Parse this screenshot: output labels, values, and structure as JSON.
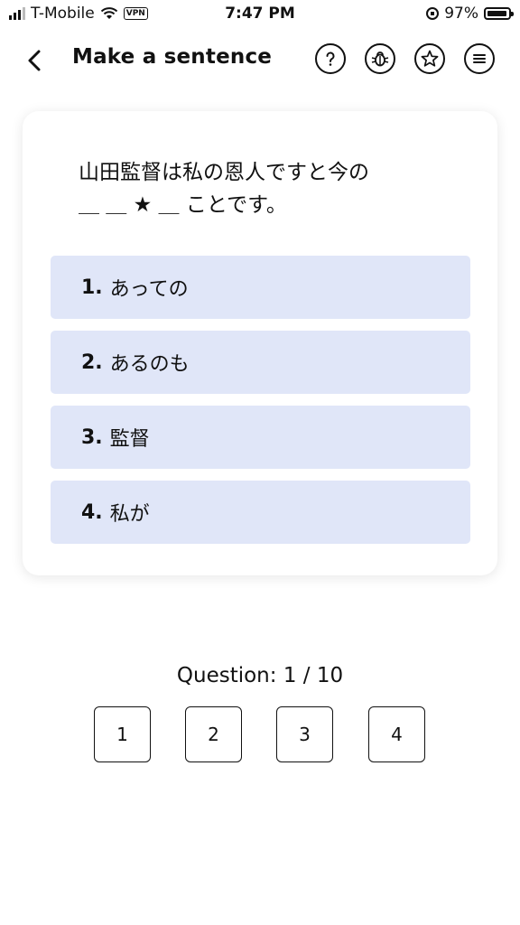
{
  "status_bar": {
    "carrier": "T-Mobile",
    "vpn_label": "VPN",
    "time": "7:47 PM",
    "battery_percent": "97%",
    "battery_level": 0.97
  },
  "header": {
    "title": "Make a sentence",
    "back_icon": "chevron-left-icon",
    "actions": [
      "help-icon",
      "bug-icon",
      "star-icon",
      "menu-icon"
    ]
  },
  "question": {
    "line1": "山田監督は私の恩人ですと今の",
    "line2": "＿ ＿ ★ ＿ ことです。"
  },
  "options": [
    {
      "number": "1.",
      "text": "あっての"
    },
    {
      "number": "2.",
      "text": "あるのも"
    },
    {
      "number": "3.",
      "text": "監督"
    },
    {
      "number": "4.",
      "text": "私が"
    }
  ],
  "progress": {
    "label": "Question: 1 / 10"
  },
  "answer_slots": [
    "1",
    "2",
    "3",
    "4"
  ],
  "colors": {
    "option_bg": "#e0e6f8",
    "text": "#111111"
  }
}
